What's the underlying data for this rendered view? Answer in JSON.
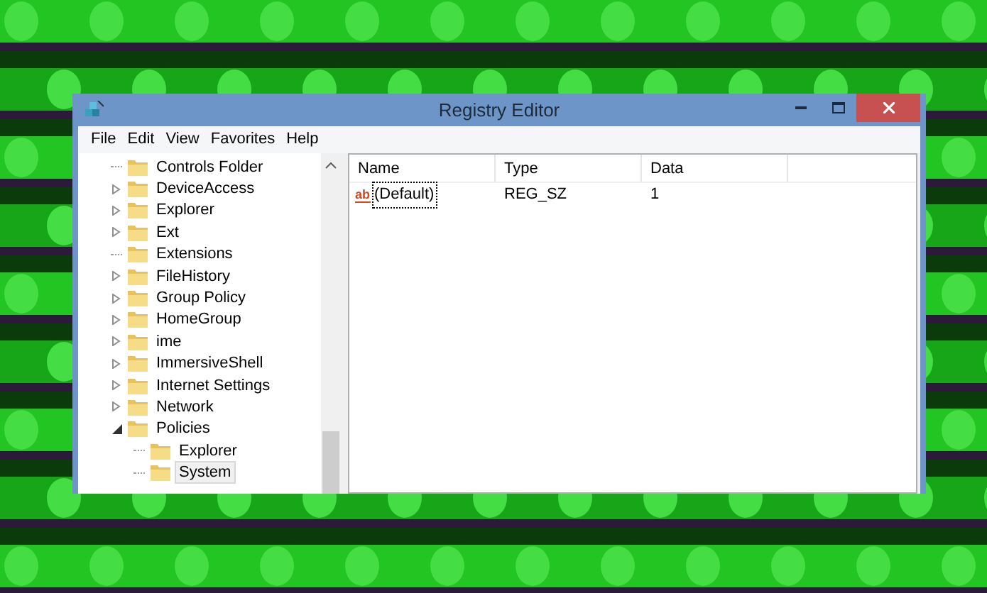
{
  "window": {
    "title": "Registry Editor"
  },
  "menu": [
    "File",
    "Edit",
    "View",
    "Favorites",
    "Help"
  ],
  "tree": [
    {
      "label": "Controls Folder",
      "expandable": false,
      "expanded": false,
      "selected": false
    },
    {
      "label": "DeviceAccess",
      "expandable": true,
      "expanded": false,
      "selected": false
    },
    {
      "label": "Explorer",
      "expandable": true,
      "expanded": false,
      "selected": false
    },
    {
      "label": "Ext",
      "expandable": true,
      "expanded": false,
      "selected": false
    },
    {
      "label": "Extensions",
      "expandable": false,
      "expanded": false,
      "selected": false
    },
    {
      "label": "FileHistory",
      "expandable": true,
      "expanded": false,
      "selected": false
    },
    {
      "label": "Group Policy",
      "expandable": true,
      "expanded": false,
      "selected": false
    },
    {
      "label": "HomeGroup",
      "expandable": true,
      "expanded": false,
      "selected": false
    },
    {
      "label": "ime",
      "expandable": true,
      "expanded": false,
      "selected": false
    },
    {
      "label": "ImmersiveShell",
      "expandable": true,
      "expanded": false,
      "selected": false
    },
    {
      "label": "Internet Settings",
      "expandable": true,
      "expanded": false,
      "selected": false
    },
    {
      "label": "Network",
      "expandable": true,
      "expanded": false,
      "selected": false
    },
    {
      "label": "Policies",
      "expandable": true,
      "expanded": true,
      "selected": false,
      "children": [
        {
          "label": "Explorer",
          "expandable": false,
          "expanded": false,
          "selected": false
        },
        {
          "label": "System",
          "expandable": false,
          "expanded": false,
          "selected": true
        }
      ]
    }
  ],
  "table": {
    "columns": [
      "Name",
      "Type",
      "Data"
    ],
    "rows": [
      {
        "icon": "ab",
        "name": "(Default)",
        "type": "REG_SZ",
        "data": "1",
        "selected": true
      }
    ]
  }
}
